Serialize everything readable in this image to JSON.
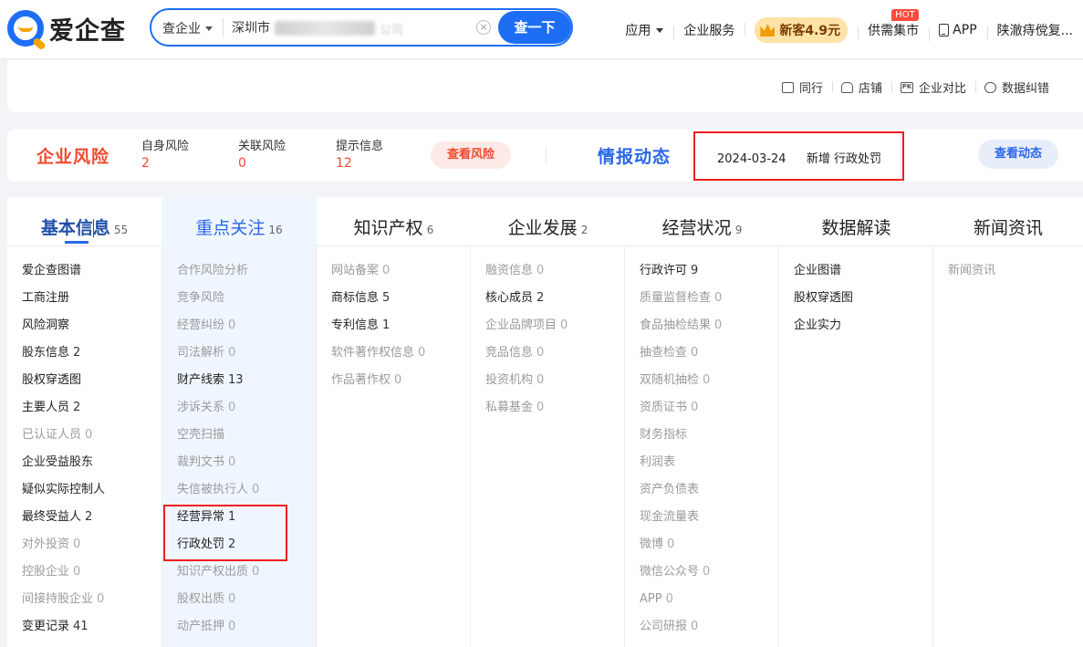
{
  "brand": {
    "name": "爱企查"
  },
  "search": {
    "type_label": "查企业",
    "value": "深圳市",
    "value_tail": "公司",
    "clear": "×",
    "button": "查一下"
  },
  "topnav": {
    "apps": "应用",
    "services": "企业服务",
    "promo": "新客4.9元",
    "supply": "供需集市",
    "hot": "HOT",
    "app": "APP",
    "user": "陕澈痔傥复..."
  },
  "actions": [
    {
      "label": "同行",
      "icon": "briefcase-icon"
    },
    {
      "label": "店铺",
      "icon": "shop-icon"
    },
    {
      "label": "企业对比",
      "icon": "pk-icon",
      "icon_text": "PK"
    },
    {
      "label": "数据纠错",
      "icon": "bug-icon"
    }
  ],
  "risk": {
    "title": "企业风险",
    "self": {
      "label": "自身风险",
      "value": "2"
    },
    "related": {
      "label": "关联风险",
      "value": "0"
    },
    "hint": {
      "label": "提示信息",
      "value": "12"
    },
    "button": "查看风险"
  },
  "intel": {
    "title": "情报动态",
    "date": "2024-03-24",
    "text": "新增 行政处罚",
    "button": "查看动态"
  },
  "tabs": [
    {
      "label": "基本信息",
      "count": "55"
    },
    {
      "label": "重点关注",
      "count": "16"
    },
    {
      "label": "知识产权",
      "count": "6"
    },
    {
      "label": "企业发展",
      "count": "2"
    },
    {
      "label": "经营状况",
      "count": "9"
    },
    {
      "label": "数据解读",
      "count": ""
    },
    {
      "label": "新闻资讯",
      "count": ""
    }
  ],
  "columns": [
    [
      {
        "label": "爱企查图谱",
        "count": "",
        "dim": false
      },
      {
        "label": "工商注册",
        "count": "",
        "dim": false
      },
      {
        "label": "风险洞察",
        "count": "",
        "dim": false
      },
      {
        "label": "股东信息",
        "count": "2",
        "dim": false
      },
      {
        "label": "股权穿透图",
        "count": "",
        "dim": false
      },
      {
        "label": "主要人员",
        "count": "2",
        "dim": false
      },
      {
        "label": "已认证人员",
        "count": "0",
        "dim": true
      },
      {
        "label": "企业受益股东",
        "count": "",
        "dim": false
      },
      {
        "label": "疑似实际控制人",
        "count": "",
        "dim": false
      },
      {
        "label": "最终受益人",
        "count": "2",
        "dim": false
      },
      {
        "label": "对外投资",
        "count": "0",
        "dim": true
      },
      {
        "label": "控股企业",
        "count": "0",
        "dim": true
      },
      {
        "label": "间接持股企业",
        "count": "0",
        "dim": true
      },
      {
        "label": "变更记录",
        "count": "41",
        "dim": false
      }
    ],
    [
      {
        "label": "合作风险分析",
        "count": "",
        "dim": true
      },
      {
        "label": "竞争风险",
        "count": "",
        "dim": true
      },
      {
        "label": "经营纠纷",
        "count": "0",
        "dim": true
      },
      {
        "label": "司法解析",
        "count": "0",
        "dim": true
      },
      {
        "label": "财产线索",
        "count": "13",
        "dim": false
      },
      {
        "label": "涉诉关系",
        "count": "0",
        "dim": true
      },
      {
        "label": "空壳扫描",
        "count": "",
        "dim": true
      },
      {
        "label": "裁判文书",
        "count": "0",
        "dim": true
      },
      {
        "label": "失信被执行人",
        "count": "0",
        "dim": true
      },
      {
        "label": "经营异常",
        "count": "1",
        "dim": false
      },
      {
        "label": "行政处罚",
        "count": "2",
        "dim": false
      },
      {
        "label": "知识产权出质",
        "count": "0",
        "dim": true
      },
      {
        "label": "股权出质",
        "count": "0",
        "dim": true
      },
      {
        "label": "动产抵押",
        "count": "0",
        "dim": true
      }
    ],
    [
      {
        "label": "网站备案",
        "count": "0",
        "dim": true
      },
      {
        "label": "商标信息",
        "count": "5",
        "dim": false
      },
      {
        "label": "专利信息",
        "count": "1",
        "dim": false
      },
      {
        "label": "软件著作权信息",
        "count": "0",
        "dim": true
      },
      {
        "label": "作品著作权",
        "count": "0",
        "dim": true
      }
    ],
    [
      {
        "label": "融资信息",
        "count": "0",
        "dim": true
      },
      {
        "label": "核心成员",
        "count": "2",
        "dim": false
      },
      {
        "label": "企业品牌项目",
        "count": "0",
        "dim": true
      },
      {
        "label": "竞品信息",
        "count": "0",
        "dim": true
      },
      {
        "label": "投资机构",
        "count": "0",
        "dim": true
      },
      {
        "label": "私募基金",
        "count": "0",
        "dim": true
      }
    ],
    [
      {
        "label": "行政许可",
        "count": "9",
        "dim": false
      },
      {
        "label": "质量监督检查",
        "count": "0",
        "dim": true
      },
      {
        "label": "食品抽检结果",
        "count": "0",
        "dim": true
      },
      {
        "label": "抽查检查",
        "count": "0",
        "dim": true
      },
      {
        "label": "双随机抽检",
        "count": "0",
        "dim": true
      },
      {
        "label": "资质证书",
        "count": "0",
        "dim": true
      },
      {
        "label": "财务指标",
        "count": "",
        "dim": true
      },
      {
        "label": "利润表",
        "count": "",
        "dim": true
      },
      {
        "label": "资产负债表",
        "count": "",
        "dim": true
      },
      {
        "label": "现金流量表",
        "count": "",
        "dim": true
      },
      {
        "label": "微博",
        "count": "0",
        "dim": true
      },
      {
        "label": "微信公众号",
        "count": "0",
        "dim": true
      },
      {
        "label": "APP",
        "count": "0",
        "dim": true
      },
      {
        "label": "公司研报",
        "count": "0",
        "dim": true
      }
    ],
    [
      {
        "label": "企业图谱",
        "count": "",
        "dim": false
      },
      {
        "label": "股权穿透图",
        "count": "",
        "dim": false
      },
      {
        "label": "企业实力",
        "count": "",
        "dim": false
      }
    ],
    [
      {
        "label": "新闻资讯",
        "count": "",
        "dim": true
      }
    ]
  ]
}
